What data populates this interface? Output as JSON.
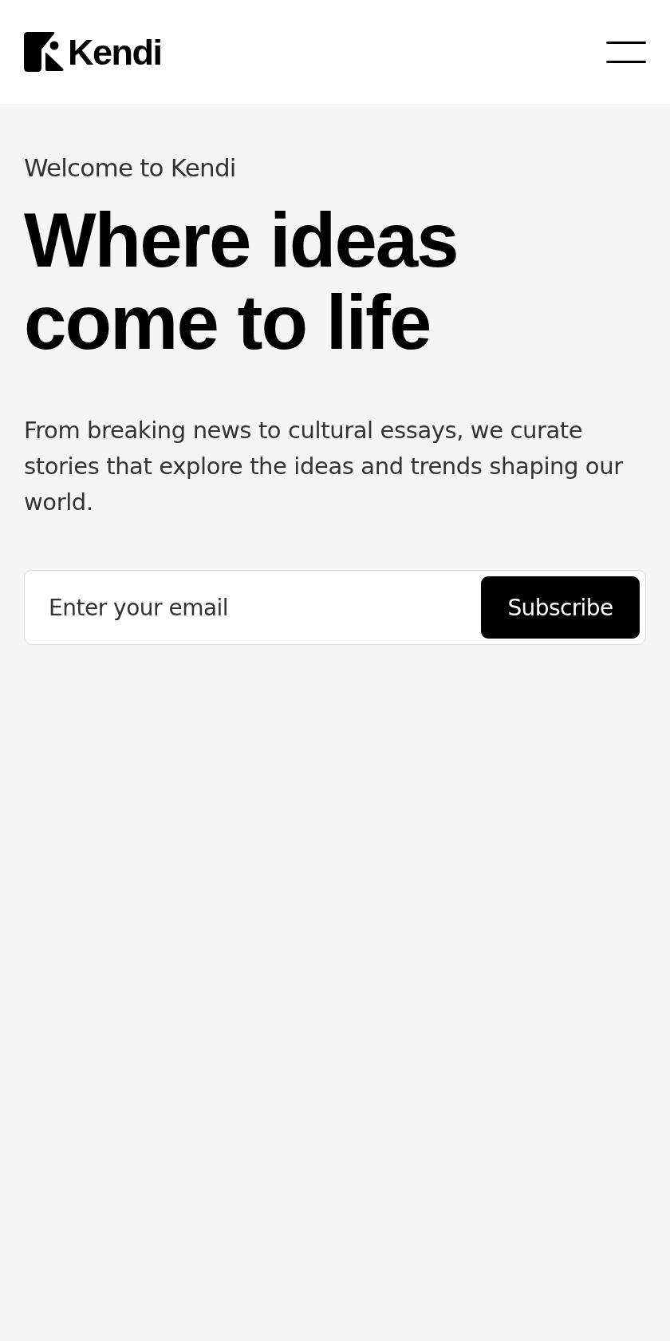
{
  "header": {
    "logo": {
      "text": "Kendi"
    }
  },
  "hero": {
    "eyebrow": "Welcome to Kendi",
    "title": "Where ideas come to life",
    "description": "From breaking news to cultural essays, we curate stories that explore the ideas and trends shaping our world.",
    "subscribe_form": {
      "placeholder": "Enter your email",
      "button": "Subscribe"
    }
  }
}
